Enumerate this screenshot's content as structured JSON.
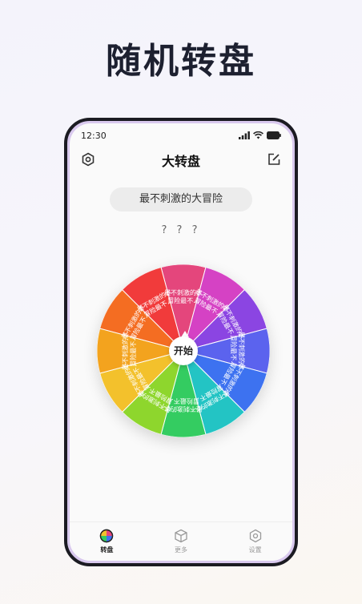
{
  "headline": "随机转盘",
  "status": {
    "time": "12:30"
  },
  "app": {
    "title": "大转盘"
  },
  "current_topic": "最不刺激的大冒险",
  "result": "? ? ?",
  "wheel": {
    "start_label": "开始",
    "segments": [
      {
        "label": "最不刺激的大冒险最不...",
        "color": "#e4467c"
      },
      {
        "label": "最不刺激的大冒险最不...",
        "color": "#d542c4"
      },
      {
        "label": "最不刺激的大冒险最不...",
        "color": "#8b45e2"
      },
      {
        "label": "最不刺激的大冒险最不...",
        "color": "#5b63ee"
      },
      {
        "label": "最不刺激的大冒险最不...",
        "color": "#3d72f0"
      },
      {
        "label": "最不刺激的大冒险最不...",
        "color": "#23c4c4"
      },
      {
        "label": "最不刺激的大冒险最不...",
        "color": "#34cc61"
      },
      {
        "label": "最不刺激的大冒险最不...",
        "color": "#8ed62d"
      },
      {
        "label": "最不刺激的大冒险最不...",
        "color": "#f3c12c"
      },
      {
        "label": "最不刺激的大冒险最不...",
        "color": "#f3a31e"
      },
      {
        "label": "最不刺激的大冒险最不...",
        "color": "#f46d22"
      },
      {
        "label": "最不刺激的大冒险最不...",
        "color": "#f13b3b"
      }
    ]
  },
  "tabs": [
    {
      "label": "转盘",
      "icon": "wheel-icon",
      "active": true
    },
    {
      "label": "更多",
      "icon": "cube-icon",
      "active": false
    },
    {
      "label": "设置",
      "icon": "hexagon-settings-icon",
      "active": false
    }
  ]
}
